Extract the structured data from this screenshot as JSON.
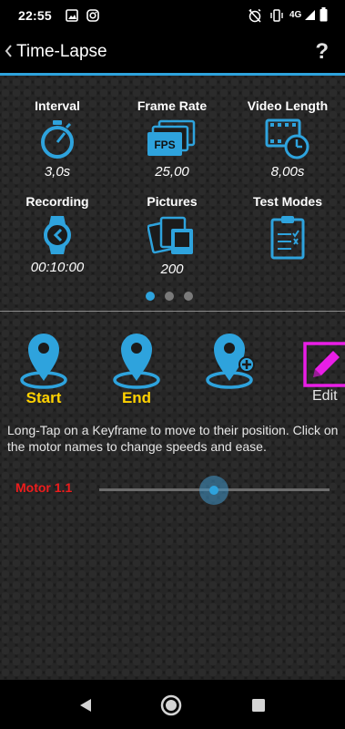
{
  "status_bar": {
    "time": "22:55",
    "network": "4G",
    "icons": [
      "image-icon",
      "instagram-icon",
      "alarm-off-icon",
      "vibrate-icon",
      "signal-icon",
      "battery-icon"
    ]
  },
  "action_bar": {
    "title": "Time-Lapse",
    "help": "?"
  },
  "stats": {
    "interval": {
      "label": "Interval",
      "value": "3,0s",
      "icon": "stopwatch-icon"
    },
    "frame_rate": {
      "label": "Frame Rate",
      "value": "25,00",
      "icon": "fps-icon"
    },
    "video_length": {
      "label": "Video Length",
      "value": "8,00s",
      "icon": "film-clock-icon"
    },
    "recording": {
      "label": "Recording",
      "value": "00:10:00",
      "icon": "watch-icon"
    },
    "pictures": {
      "label": "Pictures",
      "value": "200",
      "icon": "pictures-icon"
    },
    "test_modes": {
      "label": "Test Modes",
      "icon": "checklist-icon"
    }
  },
  "pager": {
    "active_index": 0,
    "count": 3
  },
  "keyframes": {
    "start_label": "Start",
    "end_label": "End",
    "edit_label": "Edit"
  },
  "info_text": "Long-Tap on a Keyframe to move to their position. Click on the motor names to change speeds and ease.",
  "motor": {
    "name": "Motor 1.1",
    "position": 0.5
  },
  "colors": {
    "accent": "#2ea3dd",
    "keyframe_label": "#ffd200",
    "edit": "#e91ee6",
    "motor": "#ee1c1c"
  }
}
